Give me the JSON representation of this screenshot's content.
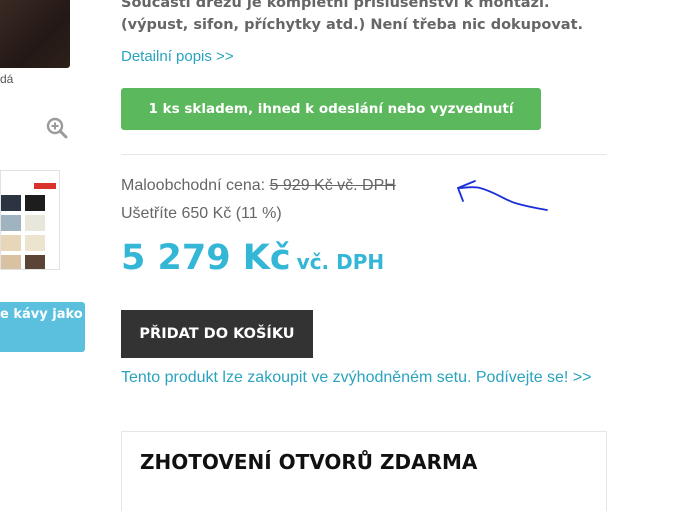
{
  "left": {
    "image_caption": "dá",
    "zoom_icon": "zoom-in-icon",
    "side_button_label": "e kávy jako"
  },
  "main": {
    "description": "Součástí dřezu je kompletní příslušenství k montáži. (výpust, sifon, příchytky atd.) Není třeba nic dokupovat.",
    "detail_link": "Detailní popis >>",
    "stock_button": "1 ks skladem, ihned k odeslání nebo vyzvednutí",
    "retail_label": "Maloobchodní cena:",
    "retail_price": "5 929 Kč vč. DPH",
    "savings": "Ušetříte 650 Kč (11 %)",
    "price_amount": "5 279 Kč",
    "price_vat": "vč. DPH",
    "add_to_cart": "PŘIDAT DO KOŠÍKU",
    "set_link": "Tento produkt lze zakoupit ve zvýhodněném setu. Podívejte se! >>",
    "holes_title": "ZHOTOVENÍ OTVORŮ ZDARMA"
  },
  "colors": {
    "accent_blue": "#34b6d6",
    "link_blue": "#2aa3bf",
    "stock_green": "#5cb85c",
    "cart_dark": "#333333",
    "annotation_arrow": "#1b2fd6"
  }
}
